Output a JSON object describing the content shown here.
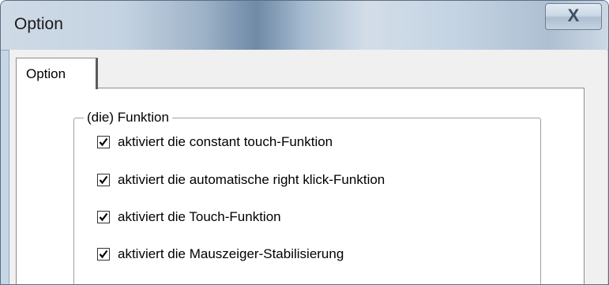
{
  "window": {
    "title": "Option",
    "close_glyph": "X"
  },
  "tabs": [
    {
      "label": "Option",
      "selected": true
    }
  ],
  "group": {
    "legend": "(die) Funktion",
    "options": [
      {
        "label": "aktiviert die constant touch-Funktion",
        "checked": true
      },
      {
        "label": "aktiviert die automatische right klick-Funktion",
        "checked": true
      },
      {
        "label": "aktiviert die Touch-Funktion",
        "checked": true
      },
      {
        "label": "aktiviert die Mauszeiger-Stabilisierung",
        "checked": true
      }
    ]
  }
}
